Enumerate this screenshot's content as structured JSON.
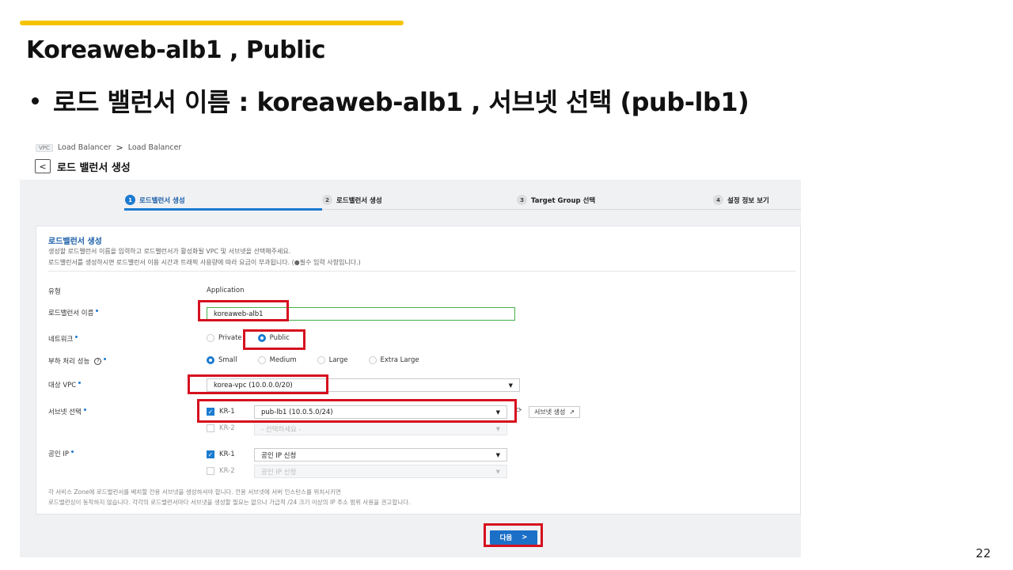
{
  "slide": {
    "title": "Koreaweb-alb1 , Public",
    "bullet": "로드 밸런서 이름 : koreaweb-alb1 , 서브넷 선택 (pub-lb1)",
    "page_number": "22"
  },
  "breadcrumb": {
    "badge": "VPC",
    "items": [
      "Load Balancer",
      "Load Balancer"
    ],
    "separator": ">"
  },
  "page": {
    "back_symbol": "<",
    "title": "로드 밸런서 생성"
  },
  "stepper": {
    "steps": [
      {
        "num": "1",
        "label": "로드밸런서 생성"
      },
      {
        "num": "2",
        "label": "로드밸런서 생성"
      },
      {
        "num": "3",
        "label": "Target Group 선택"
      },
      {
        "num": "4",
        "label": "설정 정보 보기"
      }
    ]
  },
  "card": {
    "title": "로드밸런서 생성",
    "desc1": "생성할 로드밸런서 이름을 입력하고 로드밸런서가 활성화될 VPC 및 서브넷을 선택해주세요.",
    "desc2": "로드밸런서를 생성하시면 로드밸런서 이용 시간과 트래픽 사용량에 따라 요금이 부과됩니다. (●필수 입력 사항입니다.)"
  },
  "form": {
    "type_label": "유형",
    "type_value": "Application",
    "name_label": "로드밸런서 이름",
    "name_value": "koreaweb-alb1",
    "network_label": "네트워크",
    "network_options": [
      "Private",
      "Public"
    ],
    "capacity_label": "부하 처리 성능",
    "capacity_help": "?",
    "capacity_options": [
      "Small",
      "Medium",
      "Large",
      "Extra Large"
    ],
    "vpc_label": "대상 VPC",
    "vpc_value": "korea-vpc (10.0.0.0/20)",
    "subnet_label": "서브넷 선택",
    "subnet_zone1": "KR-1",
    "subnet_zone1_value": "pub-lb1 (10.0.5.0/24)",
    "subnet_zone2": "KR-2",
    "subnet_zone2_value": "- 선택하세요 -",
    "subnet_create_label": "서브넷 생성",
    "ip_label": "공인 IP",
    "ip_zone1": "KR-1",
    "ip_zone1_value": "공인 IP 신청",
    "ip_zone2": "KR-2",
    "ip_zone2_value": "공인 IP 신청",
    "caret": "▼",
    "check_mark": "✓",
    "refresh_symbol": "⟳",
    "external_symbol": "↗"
  },
  "footnote": {
    "line1": "각 서비스 Zone에 로드밸런서를 배치할 전용 서브넷을 생성하셔야 합니다. 전용 서브넷에 서버 인스턴스를 위치시키면",
    "line2": "로드밸런싱이 동작하지 않습니다. 각각의 로드밸런서마다 서브넷을 생성할 필요는 없으나 가급적 /24 크기 이상의 IP 주소 범위 사용을 권고합니다."
  },
  "next_button": {
    "label": "다음",
    "arrow": ">"
  },
  "colors": {
    "accent_bar": "#f5c400",
    "highlight_box": "#d6101e",
    "primary_blue": "#1b7bd0",
    "input_focus_green": "#46b04b"
  }
}
